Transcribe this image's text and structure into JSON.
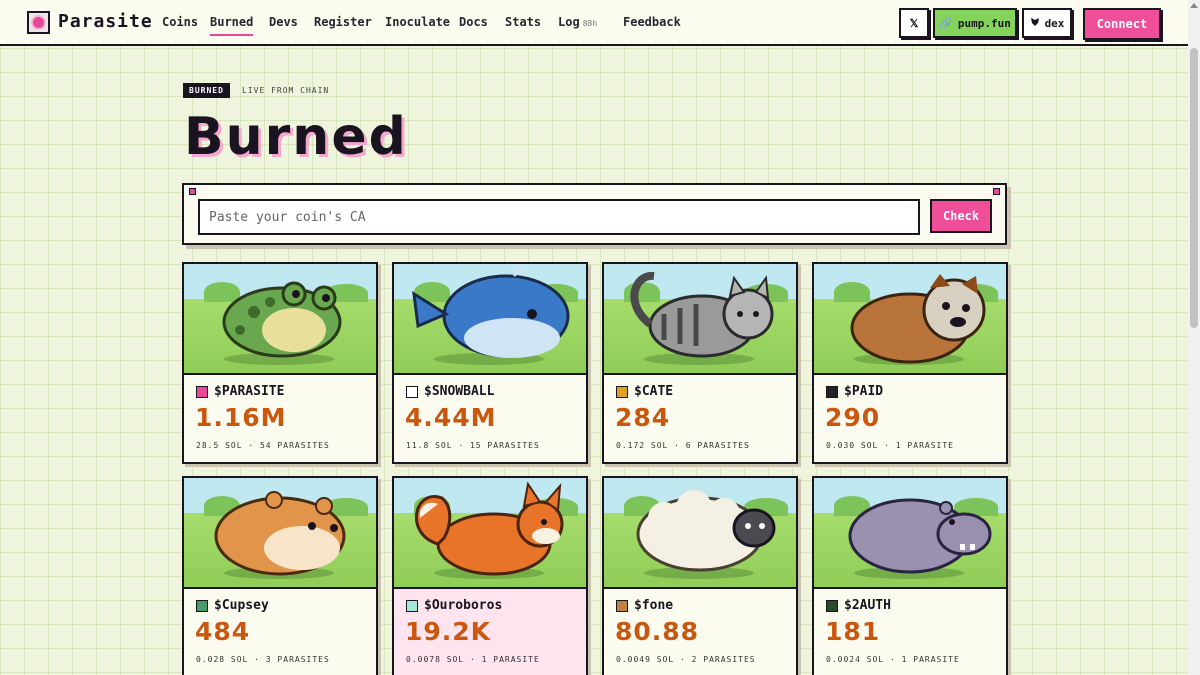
{
  "nav": {
    "brand": "Parasite",
    "links": [
      "Coins",
      "Burned",
      "Devs",
      "Register",
      "Inoculate",
      "Docs",
      "Stats",
      "Log",
      "Feedback"
    ],
    "log_badge": "88h",
    "x_label": "𝕏",
    "pump_label": "pump.fun",
    "dex_label": "dex",
    "connect_label": "Connect"
  },
  "header": {
    "badge": "BURNED",
    "subtitle": "LIVE FROM CHAIN",
    "title": "Burned"
  },
  "search": {
    "placeholder": "Paste your coin's CA",
    "button": "Check"
  },
  "cards": [
    {
      "ticker": "$PARASITE",
      "amount": "1.16M",
      "meta": "28.5 SOL · 54 PARASITES",
      "animal": "frog",
      "token_color": "#e8479a"
    },
    {
      "ticker": "$SNOWBALL",
      "amount": "4.44M",
      "meta": "11.8 SOL · 15 PARASITES",
      "animal": "whale",
      "token_color": "#ffffff"
    },
    {
      "ticker": "$CATE",
      "amount": "284",
      "meta": "0.172 SOL · 6 PARASITES",
      "animal": "cat",
      "token_color": "#e0a020"
    },
    {
      "ticker": "$PAID",
      "amount": "290",
      "meta": "0.030 SOL · 1 PARASITE",
      "animal": "bulldog",
      "token_color": "#222222"
    },
    {
      "ticker": "$Cupsey",
      "amount": "484",
      "meta": "0.028 SOL · 3 PARASITES",
      "animal": "hamster",
      "token_color": "#4a9a6a"
    },
    {
      "ticker": "$Ouroboros",
      "amount": "19.2K",
      "meta": "0.0078 SOL · 1 PARASITE",
      "animal": "fox",
      "token_color": "#a8e6d8"
    },
    {
      "ticker": "$fone",
      "amount": "80.88",
      "meta": "0.0049 SOL · 2 PARASITES",
      "animal": "sheep",
      "token_color": "#c08040"
    },
    {
      "ticker": "$2AUTH",
      "amount": "181",
      "meta": "0.0024 SOL · 1 PARASITE",
      "animal": "hippo",
      "token_color": "#2a4a2a"
    }
  ]
}
